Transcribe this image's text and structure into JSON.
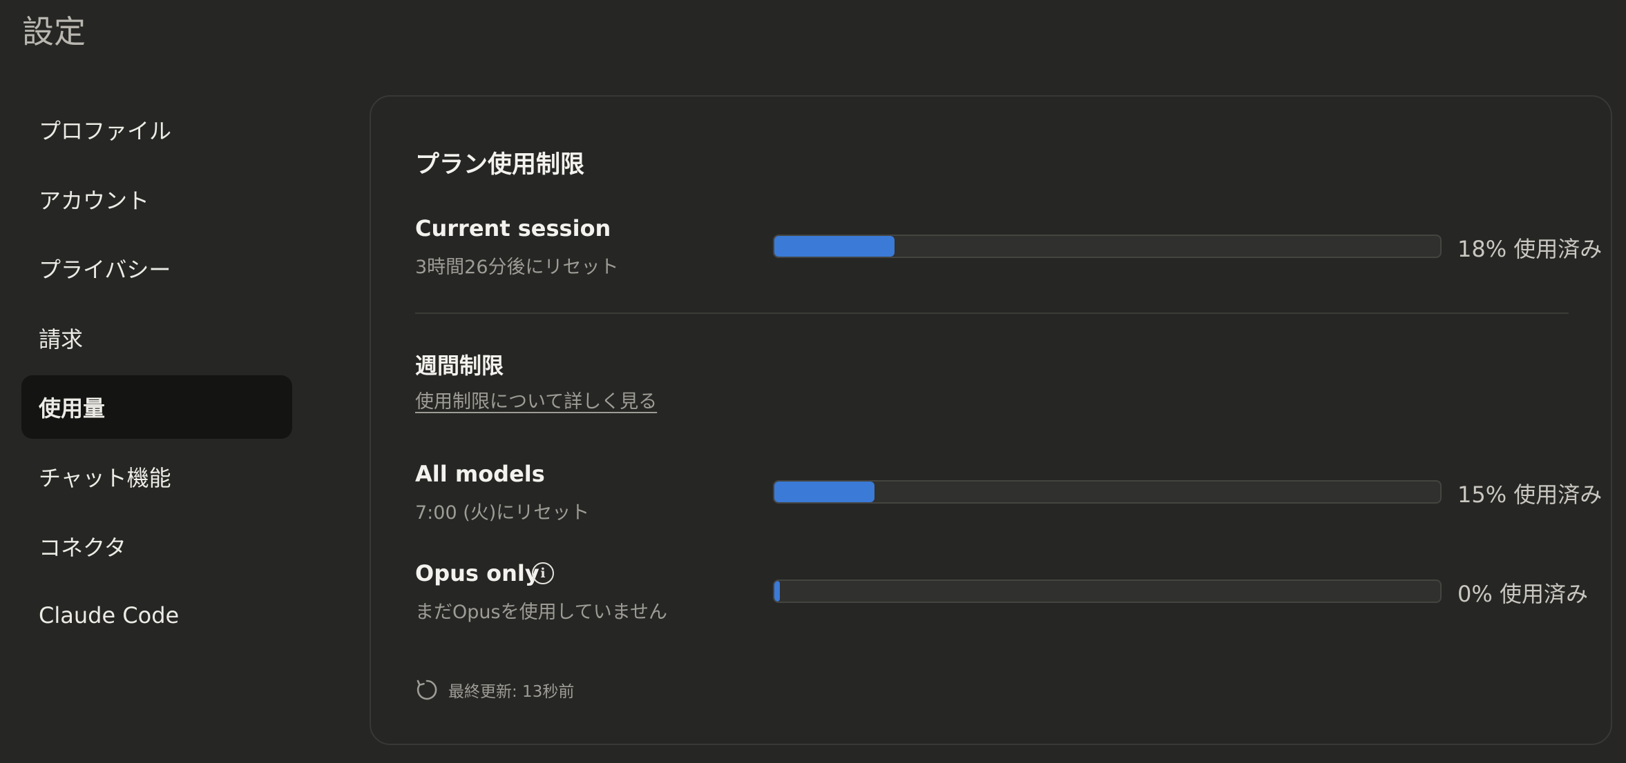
{
  "page_title": "設定",
  "sidebar": {
    "items": [
      {
        "label": "プロファイル",
        "active": false
      },
      {
        "label": "アカウント",
        "active": false
      },
      {
        "label": "プライバシー",
        "active": false
      },
      {
        "label": "請求",
        "active": false
      },
      {
        "label": "使用量",
        "active": true
      },
      {
        "label": "チャット機能",
        "active": false
      },
      {
        "label": "コネクタ",
        "active": false
      },
      {
        "label": "Claude Code",
        "active": false
      }
    ]
  },
  "usage": {
    "title": "プラン使用制限",
    "current_session": {
      "label": "Current session",
      "sub": "3時間26分後にリセット",
      "percent": 18,
      "percent_text": "18% 使用済み"
    },
    "weekly": {
      "title": "週間制限",
      "link": "使用制限について詳しく見る"
    },
    "all_models": {
      "label": "All models",
      "sub": "7:00 (火)にリセット",
      "percent": 15,
      "percent_text": "15% 使用済み"
    },
    "opus_only": {
      "label": "Opus only",
      "sub": "まだOpusを使用していません",
      "percent": 0,
      "percent_text": "0% 使用済み",
      "info_icon": "info-icon"
    },
    "last_updated": "最終更新: 13秒前"
  },
  "colors": {
    "background": "#262624",
    "bar_fill": "#3b7ad6",
    "active_nav": "#141413"
  }
}
